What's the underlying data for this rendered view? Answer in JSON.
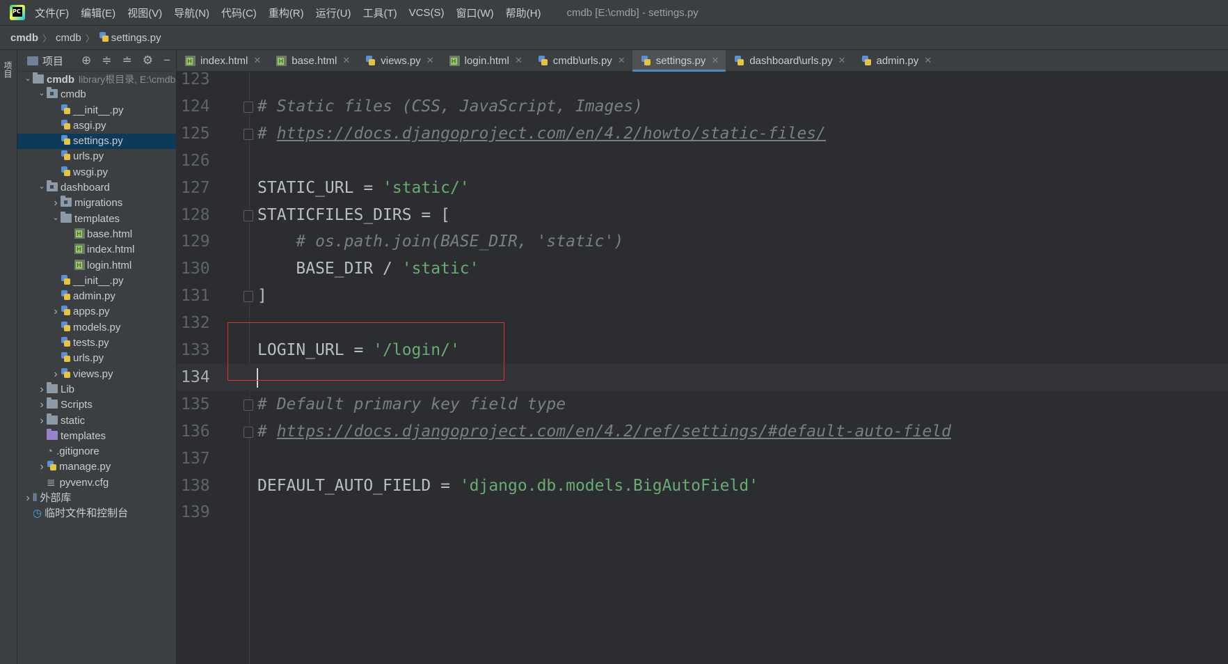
{
  "menubar": {
    "logo": "PC",
    "items": [
      "文件(F)",
      "编辑(E)",
      "视图(V)",
      "导航(N)",
      "代码(C)",
      "重构(R)",
      "运行(U)",
      "工具(T)",
      "VCS(S)",
      "窗口(W)",
      "帮助(H)"
    ],
    "window_title": "cmdb [E:\\cmdb] - settings.py"
  },
  "breadcrumb": {
    "root": "cmdb",
    "folder": "cmdb",
    "file": "settings.py"
  },
  "left_strip": {
    "project_tab": "项目"
  },
  "project_panel": {
    "title": "项目",
    "tree": [
      {
        "label": "cmdb",
        "extra": "library根目录,  E:\\cmdb",
        "type": "folder",
        "arrow": "v"
      },
      {
        "label": "cmdb",
        "type": "module",
        "arrow": "v"
      },
      {
        "label": "__init__.py",
        "type": "py"
      },
      {
        "label": "asgi.py",
        "type": "py"
      },
      {
        "label": "settings.py",
        "type": "py"
      },
      {
        "label": "urls.py",
        "type": "py"
      },
      {
        "label": "wsgi.py",
        "type": "py"
      },
      {
        "label": "dashboard",
        "type": "module",
        "arrow": "v"
      },
      {
        "label": "migrations",
        "type": "module",
        "arrow": ">"
      },
      {
        "label": "templates",
        "type": "folder",
        "arrow": "v"
      },
      {
        "label": "base.html",
        "type": "html"
      },
      {
        "label": "index.html",
        "type": "html"
      },
      {
        "label": "login.html",
        "type": "html"
      },
      {
        "label": "__init__.py",
        "type": "py"
      },
      {
        "label": "admin.py",
        "type": "py"
      },
      {
        "label": "apps.py",
        "type": "py",
        "arrow": ">"
      },
      {
        "label": "models.py",
        "type": "py"
      },
      {
        "label": "tests.py",
        "type": "py"
      },
      {
        "label": "urls.py",
        "type": "py"
      },
      {
        "label": "views.py",
        "type": "py",
        "arrow": ">"
      },
      {
        "label": "Lib",
        "type": "folder",
        "arrow": ">"
      },
      {
        "label": "Scripts",
        "type": "folder",
        "arrow": ">"
      },
      {
        "label": "static",
        "type": "folder",
        "arrow": ">"
      },
      {
        "label": "templates",
        "type": "purple"
      },
      {
        "label": ".gitignore",
        "type": "file"
      },
      {
        "label": "manage.py",
        "type": "py",
        "arrow": ">"
      },
      {
        "label": "pyvenv.cfg",
        "type": "cfg"
      },
      {
        "label": "外部库",
        "type": "lib",
        "arrow": ">"
      },
      {
        "label": "临时文件和控制台",
        "type": "scratch"
      }
    ]
  },
  "tabs": [
    {
      "label": "index.html",
      "type": "html"
    },
    {
      "label": "base.html",
      "type": "html"
    },
    {
      "label": "views.py",
      "type": "py"
    },
    {
      "label": "login.html",
      "type": "html"
    },
    {
      "label": "cmdb\\urls.py",
      "type": "py"
    },
    {
      "label": "settings.py",
      "type": "py",
      "active": true
    },
    {
      "label": "dashboard\\urls.py",
      "type": "py"
    },
    {
      "label": "admin.py",
      "type": "py"
    }
  ],
  "editor": {
    "lines": [
      {
        "n": "123",
        "text": ""
      },
      {
        "n": "124",
        "text": "# Static files (CSS, JavaScript, Images)"
      },
      {
        "n": "125",
        "text": "# https://docs.djangoproject.com/en/4.2/howto/static-files/"
      },
      {
        "n": "126",
        "text": ""
      },
      {
        "n": "127",
        "text": "STATIC_URL = 'static/'"
      },
      {
        "n": "128",
        "text": "STATICFILES_DIRS = ["
      },
      {
        "n": "129",
        "text": "    # os.path.join(BASE_DIR, 'static')"
      },
      {
        "n": "130",
        "text": "    BASE_DIR / 'static'"
      },
      {
        "n": "131",
        "text": "]"
      },
      {
        "n": "132",
        "text": ""
      },
      {
        "n": "133",
        "text": "LOGIN_URL = '/login/'"
      },
      {
        "n": "134",
        "text": ""
      },
      {
        "n": "135",
        "text": "# Default primary key field type"
      },
      {
        "n": "136",
        "text": "# https://docs.djangoproject.com/en/4.2/ref/settings/#default-auto-field"
      },
      {
        "n": "137",
        "text": ""
      },
      {
        "n": "138",
        "text": "DEFAULT_AUTO_FIELD = 'django.db.models.BigAutoField'"
      },
      {
        "n": "139",
        "text": ""
      }
    ],
    "current_line": "134"
  },
  "colors": {
    "accent": "#4a88c7",
    "highlight_box": "#e03030",
    "string": "#6aab73",
    "comment": "#7a7e85"
  }
}
